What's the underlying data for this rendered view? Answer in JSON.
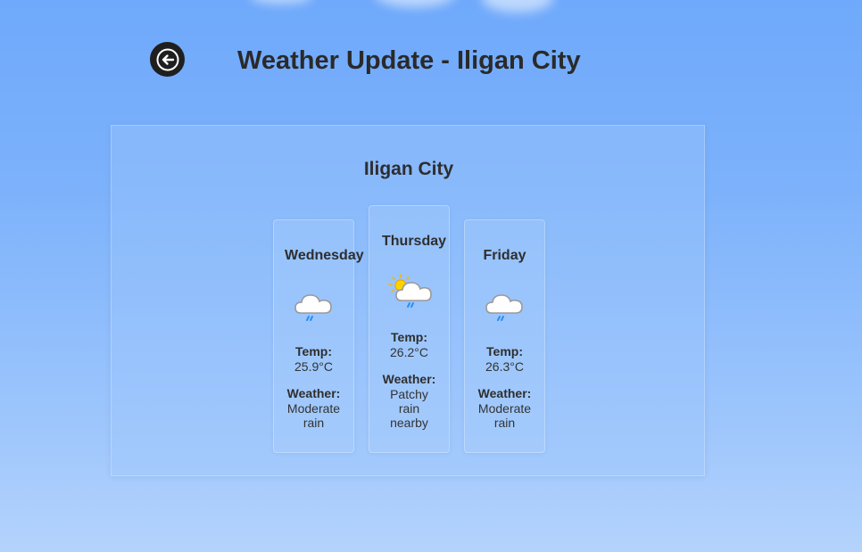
{
  "header": {
    "back_icon": "arrow-left-icon",
    "title": "Weather Update - Iligan City"
  },
  "panel": {
    "city": "Iligan City",
    "labels": {
      "temp": "Temp:",
      "weather": "Weather:"
    },
    "days": [
      {
        "name": "Wednesday",
        "icon": "rain-cloud-icon",
        "temp": "25.9°C",
        "weather_lines": [
          "Moderate",
          "rain"
        ]
      },
      {
        "name": "Thursday",
        "icon": "sun-rain-cloud-icon",
        "temp": "26.2°C",
        "weather_lines": [
          "Patchy",
          "rain",
          "nearby"
        ]
      },
      {
        "name": "Friday",
        "icon": "rain-cloud-icon",
        "temp": "26.3°C",
        "weather_lines": [
          "Moderate",
          "rain"
        ]
      }
    ]
  },
  "colors": {
    "background_top": "#6fa9fb",
    "background_bottom": "#b4d3fc",
    "back_button": "#1f1f1f",
    "text": "#2b2b2b"
  }
}
